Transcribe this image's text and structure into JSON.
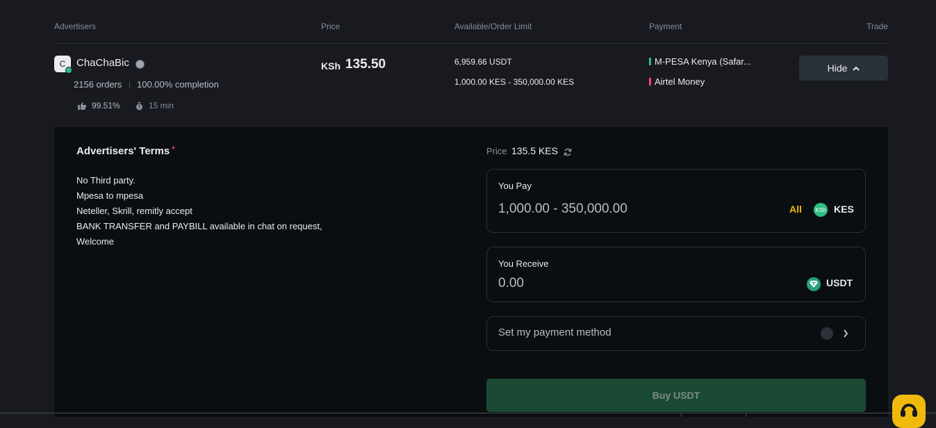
{
  "table_header": {
    "advertisers": "Advertisers",
    "price": "Price",
    "available": "Available/Order Limit",
    "payment": "Payment",
    "trade": "Trade"
  },
  "ad": {
    "avatar_letter": "C",
    "name": "ChaChaBic",
    "orders": "2156 orders",
    "completion": "100.00% completion",
    "rating": "99.51%",
    "time": "15 min",
    "price_symbol": "KSh",
    "price": "135.50",
    "available": "6,959.66 USDT",
    "limit": "1,000.00 KES - 350,000.00 KES",
    "payments": [
      {
        "label": "M-PESA Kenya (Safar...",
        "color": "#2ebd85"
      },
      {
        "label": "Airtel Money",
        "color": "#f6465d"
      }
    ],
    "hide_label": "Hide"
  },
  "terms": {
    "title": "Advertisers' Terms",
    "required_mark": "*",
    "lines": [
      "No Third party.",
      "Mpesa to mpesa",
      "Neteller, Skrill, remitly accept",
      "BANK TRANSFER and PAYBILL available in chat on request,",
      "Welcome"
    ]
  },
  "order": {
    "price_label": "Price",
    "price_value": "135.5 KES",
    "pay_label": "You Pay",
    "pay_value": "1,000.00 - 350,000.00",
    "all_label": "All",
    "pay_coin_symbol": "KSh",
    "pay_currency": "KES",
    "receive_label": "You Receive",
    "receive_value": "0.00",
    "receive_currency": "USDT",
    "payment_method_label": "Set my payment method",
    "buy_label": "Buy USDT"
  },
  "colors": {
    "accent": "#f0b90b",
    "buy_disabled": "#1a4a34",
    "kes_coin": "#2ebd85",
    "usdt_coin": "#26a17b"
  },
  "icons": {
    "verified": "verified-badge-icon",
    "thumb": "thumbs-up-icon",
    "timer": "stopwatch-icon",
    "refresh": "refresh-icon",
    "chevron_up": "chevron-up-icon",
    "chevron_right": "chevron-right-icon",
    "support": "headset-icon"
  }
}
